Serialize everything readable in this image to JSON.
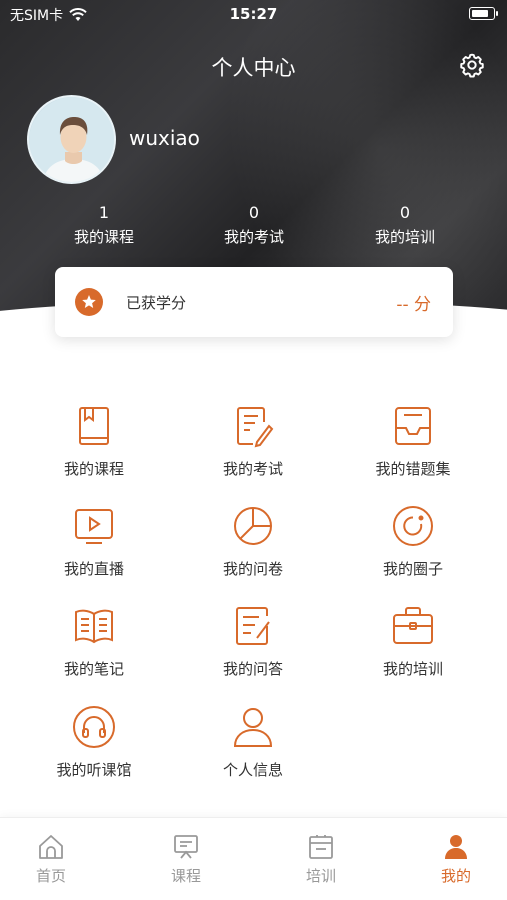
{
  "status_bar": {
    "carrier": "无SIM卡",
    "time": "15:27",
    "battery_level": 0.85
  },
  "header": {
    "title": "个人中心"
  },
  "profile": {
    "username": "wuxiao"
  },
  "stats": [
    {
      "value": "1",
      "label": "我的课程"
    },
    {
      "value": "0",
      "label": "我的考试"
    },
    {
      "value": "0",
      "label": "我的培训"
    }
  ],
  "credit": {
    "label": "已获学分",
    "value": "-- 分"
  },
  "menu": [
    {
      "label": "我的课程",
      "icon": "book-icon"
    },
    {
      "label": "我的考试",
      "icon": "exam-edit-icon"
    },
    {
      "label": "我的错题集",
      "icon": "tray-icon"
    },
    {
      "label": "我的直播",
      "icon": "video-play-icon"
    },
    {
      "label": "我的问卷",
      "icon": "pie-chart-icon"
    },
    {
      "label": "我的圈子",
      "icon": "circle-refresh-icon"
    },
    {
      "label": "我的笔记",
      "icon": "open-book-icon"
    },
    {
      "label": "我的问答",
      "icon": "qa-note-icon"
    },
    {
      "label": "我的培训",
      "icon": "briefcase-icon"
    },
    {
      "label": "我的听课馆",
      "icon": "headphones-icon"
    },
    {
      "label": "个人信息",
      "icon": "person-icon"
    }
  ],
  "tabs": [
    {
      "label": "首页",
      "icon": "home-icon"
    },
    {
      "label": "课程",
      "icon": "course-icon"
    },
    {
      "label": "培训",
      "icon": "training-icon"
    },
    {
      "label": "我的",
      "icon": "profile-icon"
    }
  ],
  "colors": {
    "accent": "#d86a2b",
    "header_dark": "#2b2b2d",
    "tab_inactive": "#999999"
  }
}
